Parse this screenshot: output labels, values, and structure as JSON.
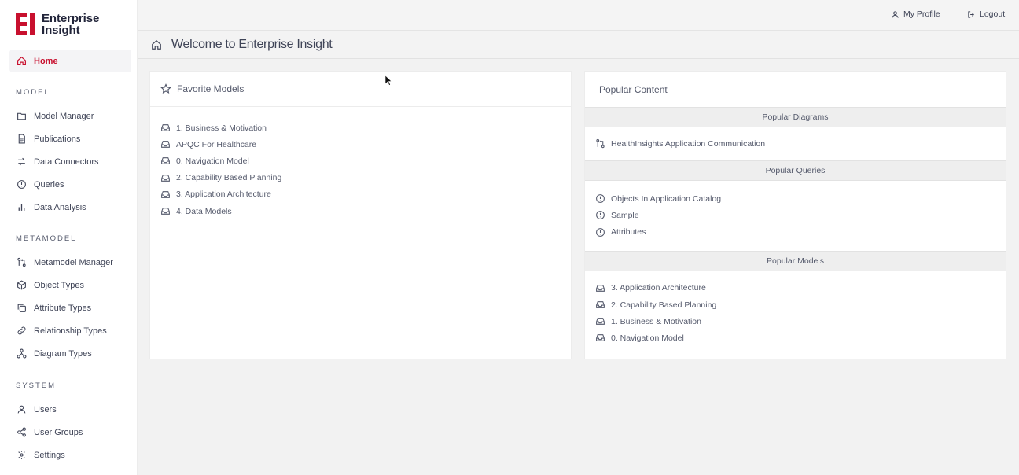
{
  "brand": {
    "line1": "Enterprise",
    "line2": "Insight",
    "accent": "#c8102e"
  },
  "sidebar": {
    "home": {
      "label": "Home",
      "icon": "home-icon"
    },
    "sections": [
      {
        "label": "MODEL",
        "items": [
          {
            "label": "Model Manager",
            "icon": "folder-icon"
          },
          {
            "label": "Publications",
            "icon": "document-icon"
          },
          {
            "label": "Data Connectors",
            "icon": "arrows-swap-icon"
          },
          {
            "label": "Queries",
            "icon": "alert-circle-icon"
          },
          {
            "label": "Data Analysis",
            "icon": "bar-chart-icon"
          }
        ]
      },
      {
        "label": "METAMODEL",
        "items": [
          {
            "label": "Metamodel Manager",
            "icon": "git-compare-icon"
          },
          {
            "label": "Object Types",
            "icon": "cube-icon"
          },
          {
            "label": "Attribute Types",
            "icon": "copy-icon"
          },
          {
            "label": "Relationship Types",
            "icon": "link-icon"
          },
          {
            "label": "Diagram Types",
            "icon": "hierarchy-icon"
          }
        ]
      },
      {
        "label": "SYSTEM",
        "items": [
          {
            "label": "Users",
            "icon": "user-icon"
          },
          {
            "label": "User Groups",
            "icon": "share-icon"
          },
          {
            "label": "Settings",
            "icon": "gear-icon"
          }
        ]
      }
    ]
  },
  "topbar": {
    "profile": "My Profile",
    "logout": "Logout"
  },
  "page": {
    "title": "Welcome to Enterprise Insight"
  },
  "favorites": {
    "title": "Favorite Models",
    "items": [
      "1. Business & Motivation",
      "APQC For Healthcare",
      "0. Navigation Model",
      "2. Capability Based Planning",
      "3. Application Architecture",
      "4. Data Models"
    ]
  },
  "popular": {
    "title": "Popular Content",
    "diagrams": {
      "heading": "Popular Diagrams",
      "items": [
        "HealthInsights Application Communication"
      ]
    },
    "queries": {
      "heading": "Popular Queries",
      "items": [
        "Objects In Application Catalog",
        "Sample",
        "Attributes"
      ]
    },
    "models": {
      "heading": "Popular Models",
      "items": [
        "3. Application Architecture",
        "2. Capability Based Planning",
        "1. Business & Motivation",
        "0. Navigation Model"
      ]
    }
  }
}
